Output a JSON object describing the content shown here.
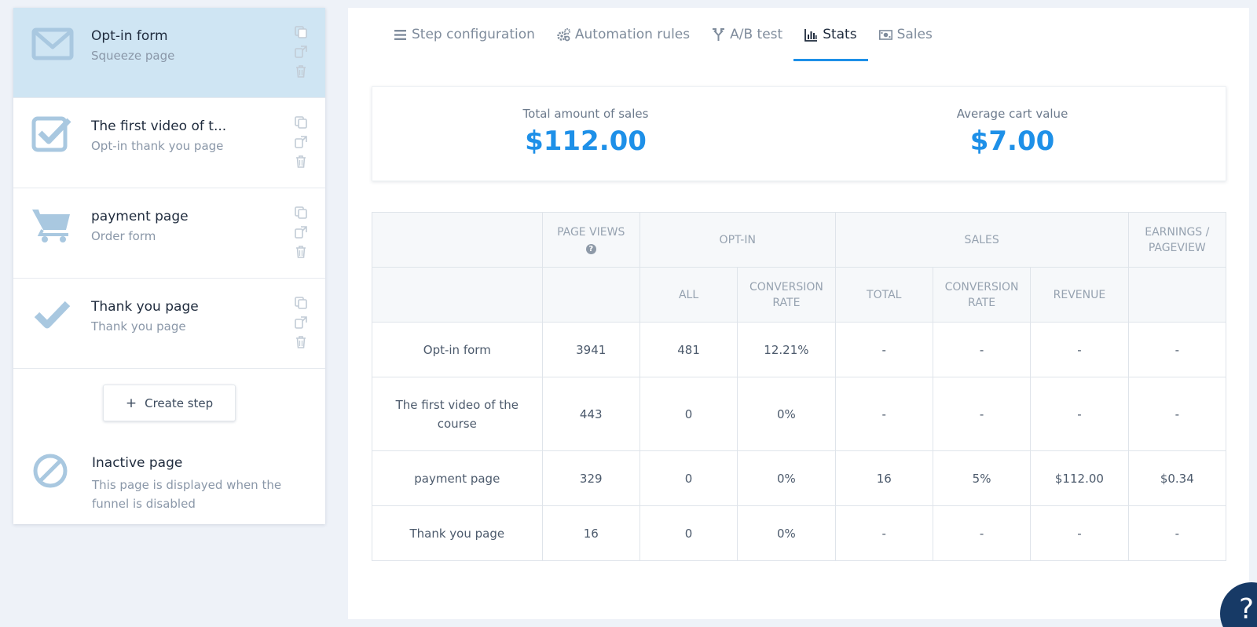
{
  "sidebar": {
    "steps": [
      {
        "title": "Opt-in form",
        "subtitle": "Squeeze page",
        "icon": "envelope-icon",
        "active": true
      },
      {
        "title": "The first video of t...",
        "subtitle": "Opt-in thank you page",
        "icon": "checkbox-icon",
        "active": false
      },
      {
        "title": "payment page",
        "subtitle": "Order form",
        "icon": "cart-icon",
        "active": false
      },
      {
        "title": "Thank you page",
        "subtitle": "Thank you page",
        "icon": "checkmark-icon",
        "active": false
      }
    ],
    "create_step_label": "Create step",
    "inactive": {
      "title": "Inactive page",
      "subtitle": "This page is displayed when the funnel is disabled"
    }
  },
  "tabs": [
    {
      "label": "Step configuration",
      "icon": "list-icon"
    },
    {
      "label": "Automation rules",
      "icon": "gears-icon"
    },
    {
      "label": "A/B test",
      "icon": "split-icon"
    },
    {
      "label": "Stats",
      "icon": "bar-chart-icon",
      "active": true
    },
    {
      "label": "Sales",
      "icon": "money-icon"
    }
  ],
  "summary": {
    "total_label": "Total amount of sales",
    "total_value": "$112.00",
    "avg_label": "Average cart value",
    "avg_value": "$7.00"
  },
  "table": {
    "headers": {
      "page_views": "Page views",
      "opt_in": "Opt-in",
      "sales": "Sales",
      "earnings": "Earnings / pageview",
      "all": "All",
      "conv_rate": "Conversion rate",
      "total": "Total",
      "revenue": "Revenue"
    },
    "rows": [
      {
        "name": "Opt-in form",
        "page_views": "3941",
        "optin_all": "481",
        "optin_rate": "12.21%",
        "sales_total": "-",
        "sales_rate": "-",
        "revenue": "-",
        "earnings": "-"
      },
      {
        "name": "The first video of the course",
        "page_views": "443",
        "optin_all": "0",
        "optin_rate": "0%",
        "sales_total": "-",
        "sales_rate": "-",
        "revenue": "-",
        "earnings": "-"
      },
      {
        "name": "payment page",
        "page_views": "329",
        "optin_all": "0",
        "optin_rate": "0%",
        "sales_total": "16",
        "sales_rate": "5%",
        "revenue": "$112.00",
        "earnings": "$0.34"
      },
      {
        "name": "Thank you page",
        "page_views": "16",
        "optin_all": "0",
        "optin_rate": "0%",
        "sales_total": "-",
        "sales_rate": "-",
        "revenue": "-",
        "earnings": "-"
      }
    ]
  },
  "help_label": "?",
  "colors": {
    "accent": "#1e90e8",
    "active_step_bg": "#cfe5f3",
    "icon": "#a9c8e0",
    "help_bubble": "#173a66"
  }
}
